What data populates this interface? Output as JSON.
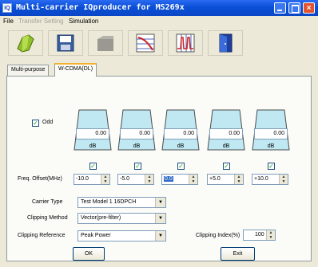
{
  "window": {
    "title": "Multi-carrier IQproducer for MS269x",
    "icon": "IQ",
    "close_glyph": "×"
  },
  "menu": [
    {
      "label": "File",
      "enabled": true
    },
    {
      "label": "Transfer Setting",
      "enabled": false
    },
    {
      "label": "Simulation",
      "enabled": true
    }
  ],
  "toolbar": {
    "icons": [
      "open-icon",
      "save-icon",
      "calculate-icon",
      "ccdf-icon",
      "fft-icon",
      "exit-icon"
    ]
  },
  "tabs": [
    {
      "label": "Multi-purpose",
      "active": false
    },
    {
      "label": "W-CDMA(DL)",
      "active": true
    }
  ],
  "odd": {
    "label": "Odd",
    "checked": true,
    "check_glyph": "✓"
  },
  "carriers": [
    {
      "level": "0.00",
      "unit": "dB",
      "enabled": true,
      "offset": "-10.0",
      "offset_selected": false
    },
    {
      "level": "0.00",
      "unit": "dB",
      "enabled": true,
      "offset": "-5.0",
      "offset_selected": false
    },
    {
      "level": "0.00",
      "unit": "dB",
      "enabled": true,
      "offset": "0.0",
      "offset_selected": true
    },
    {
      "level": "0.00",
      "unit": "dB",
      "enabled": true,
      "offset": "+5.0",
      "offset_selected": false
    },
    {
      "level": "0.00",
      "unit": "dB",
      "enabled": true,
      "offset": "+10.0",
      "offset_selected": false
    }
  ],
  "freq_offset_label": "Freq. Offset(MHz)",
  "carrier_type": {
    "label": "Carrier Type",
    "value": "Test Model 1 16DPCH"
  },
  "clipping_method": {
    "label": "Clipping Method",
    "value": "Vector(pre-filter)"
  },
  "clipping_reference": {
    "label": "Clipping Reference",
    "value": "Peak Power"
  },
  "clipping_index": {
    "label": "Clipping Index(%)",
    "value": "100"
  },
  "glyphs": {
    "up": "▲",
    "down": "▼",
    "drop": "▼"
  },
  "buttons": {
    "ok": "OK",
    "exit": "Exit"
  },
  "colors": {
    "carrier_fill": "#bfe8f2",
    "carrier_stroke": "#4a4a4a",
    "title_blue": "#0a4fd6"
  }
}
